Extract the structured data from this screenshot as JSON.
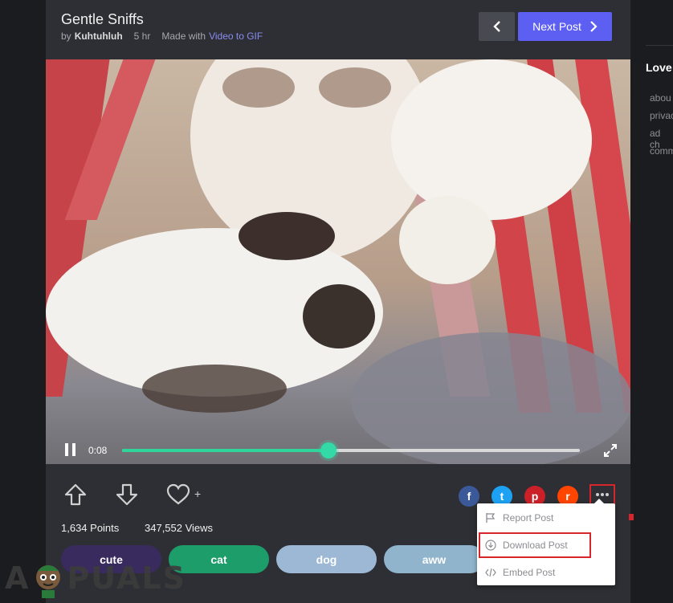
{
  "post": {
    "title": "Gentle Sniffs",
    "by_label": "by",
    "author": "Kuhtuhluh",
    "time_ago": "5 hr",
    "made_with_label": "Made with",
    "made_with_link": "Video to GIF"
  },
  "nav": {
    "next_label": "Next Post"
  },
  "player": {
    "time": "0:08",
    "progress": 0.45
  },
  "stats": {
    "points": "1,634 Points",
    "views": "347,552 Views"
  },
  "favorite_plus": "+",
  "tags": [
    {
      "label": "cute",
      "color": "#3a2b5e"
    },
    {
      "label": "cat",
      "color": "#1d9d6a"
    },
    {
      "label": "dog",
      "color": "#9cb8d4"
    },
    {
      "label": "aww",
      "color": "#8fb4cc"
    }
  ],
  "share": [
    {
      "name": "facebook-icon",
      "glyph": "f",
      "color": "#3b5998"
    },
    {
      "name": "twitter-icon",
      "glyph": "t",
      "color": "#1da1f2"
    },
    {
      "name": "pinterest-icon",
      "glyph": "p",
      "color": "#cb2027"
    },
    {
      "name": "reddit-icon",
      "glyph": "r",
      "color": "#ff4500"
    }
  ],
  "menu": {
    "items": [
      {
        "label": "Report Post",
        "icon": "flag-icon"
      },
      {
        "label": "Download Post",
        "icon": "download-icon"
      },
      {
        "label": "Embed Post",
        "icon": "code-icon"
      }
    ]
  },
  "sidebar": {
    "title": "Love",
    "lines": [
      "abou",
      "privac",
      "ad ch",
      "comm"
    ]
  },
  "watermark": {
    "left": "A",
    "right": "PUALS"
  },
  "colors": {
    "accent": "#5c5ff2",
    "highlight": "#d6262b",
    "progress": "#2fd59a"
  }
}
